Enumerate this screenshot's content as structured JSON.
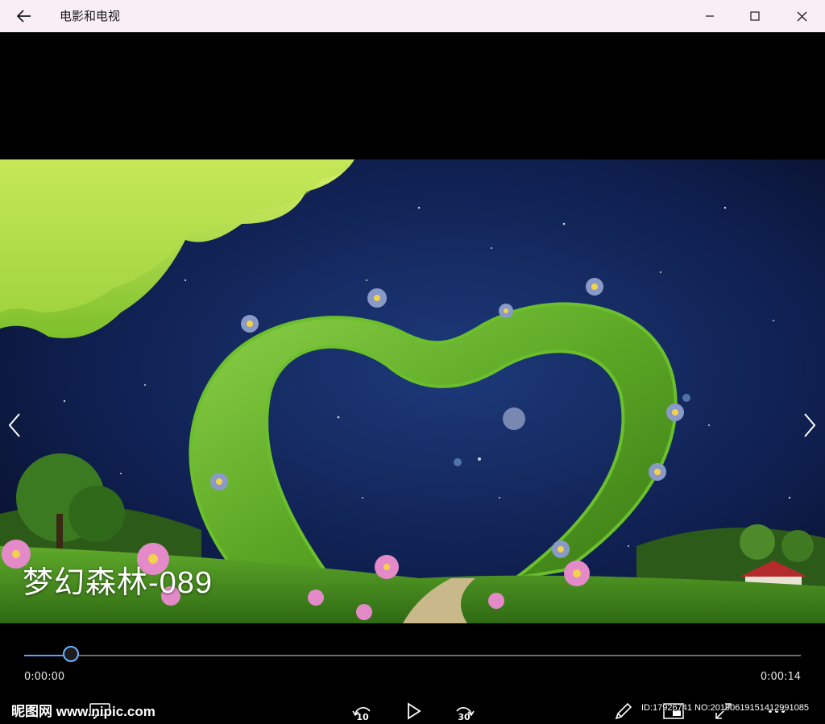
{
  "titlebar": {
    "title": "电影和电视",
    "back_icon": "arrow-left-icon",
    "minimize_icon": "minimize-icon",
    "maximize_icon": "maximize-icon",
    "close_icon": "close-icon",
    "background": "#f9eef4"
  },
  "video": {
    "subtitle": "梦幻森林-089",
    "prev_icon": "chevron-left-icon",
    "next_icon": "chevron-right-icon"
  },
  "playback": {
    "current_time": "0:00:00",
    "total_time": "0:00:14",
    "progress_fraction": 0.06,
    "accent": "#5aa0ff",
    "skip_back_label": "10",
    "skip_forward_label": "30",
    "skip_back_icon": "rewind-10-icon",
    "play_icon": "play-icon",
    "skip_forward_icon": "forward-30-icon",
    "edit_icon": "pencil-icon",
    "mini_view_icon": "mini-view-icon",
    "fullscreen_icon": "fullscreen-icon",
    "more_icon": "more-icon"
  },
  "watermarks": {
    "site": "昵图网 www.nipic.com",
    "id_text": "ID:17926741 NO:20190619151412991085"
  }
}
